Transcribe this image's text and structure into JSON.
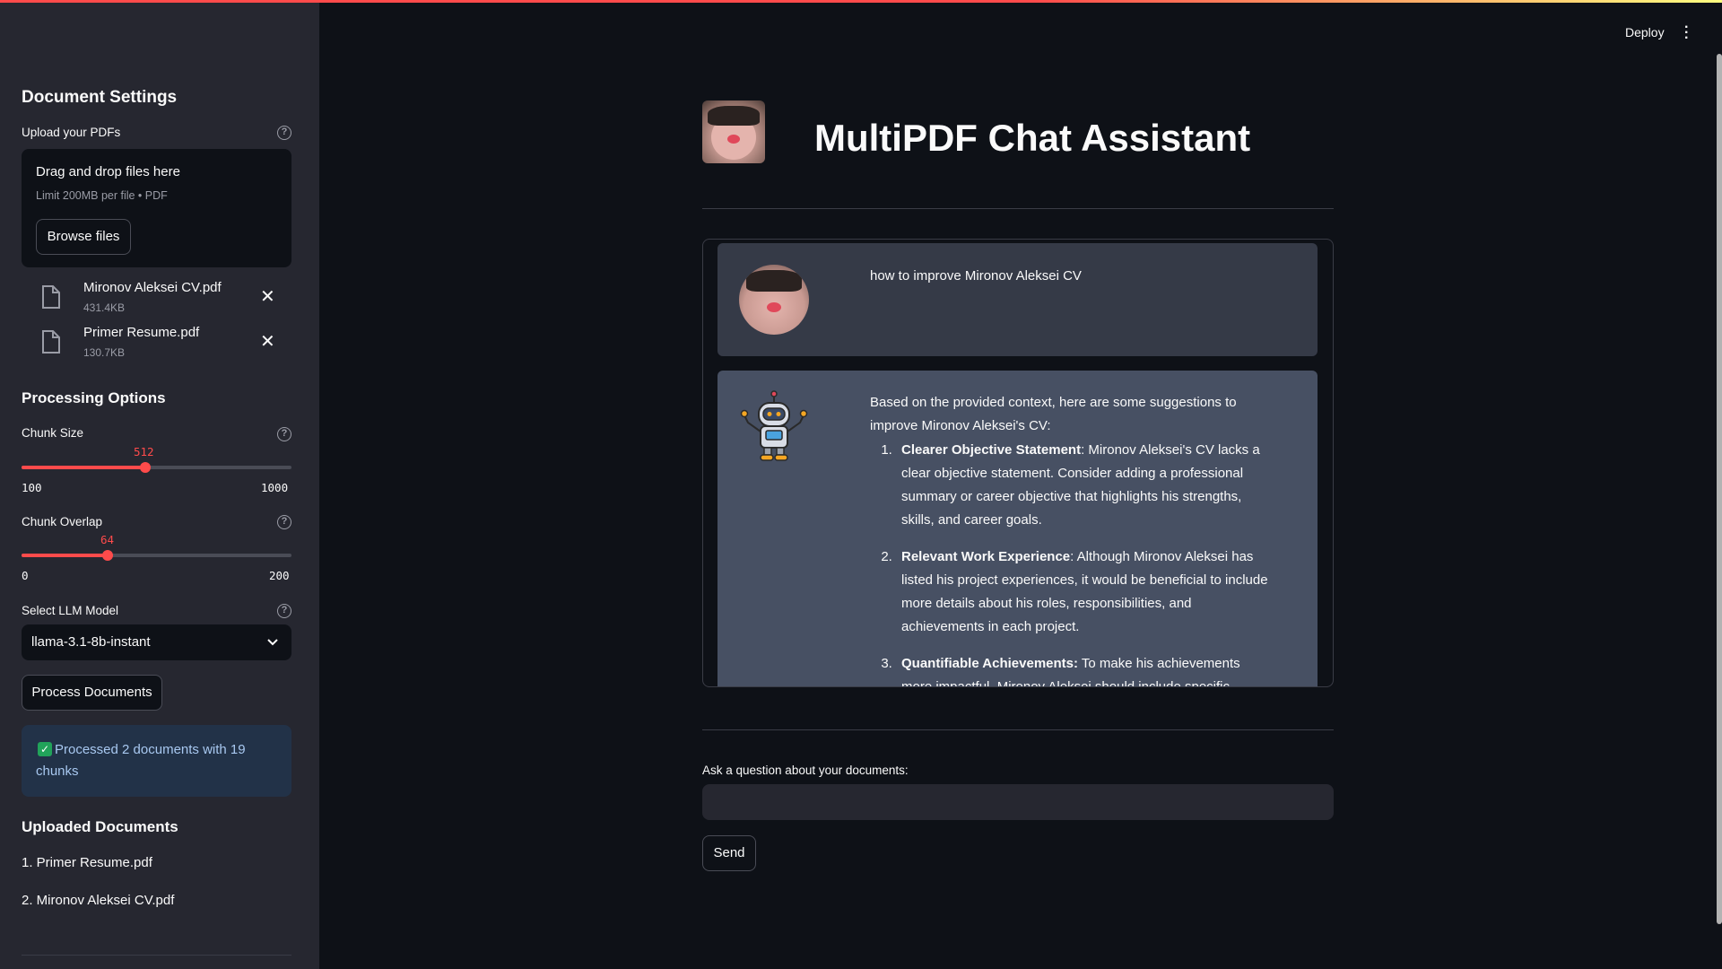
{
  "sidebar": {
    "settings_title": "Document Settings",
    "upload_label": "Upload your PDFs",
    "dropzone_title": "Drag and drop files here",
    "dropzone_limit": "Limit 200MB per file • PDF",
    "browse_label": "Browse files",
    "files": [
      {
        "name": "Mironov Aleksei CV.pdf",
        "size": "431.4KB"
      },
      {
        "name": "Primer Resume.pdf",
        "size": "130.7KB"
      }
    ],
    "processing_title": "Processing Options",
    "chunk_size": {
      "label": "Chunk Size",
      "value": "512",
      "min": "100",
      "max": "1000",
      "fraction": 0.458
    },
    "chunk_overlap": {
      "label": "Chunk Overlap",
      "value": "64",
      "min": "0",
      "max": "200",
      "fraction": 0.32
    },
    "model_label": "Select LLM Model",
    "model_value": "llama-3.1-8b-instant",
    "process_button": "Process Documents",
    "success_text": "Processed 2 documents with 19 chunks",
    "uploaded_title": "Uploaded Documents",
    "uploaded_docs": [
      "1. Primer Resume.pdf",
      "2. Mironov Aleksei CV.pdf"
    ]
  },
  "header": {
    "deploy_label": "Deploy"
  },
  "main": {
    "title": "MultiPDF Chat Assistant",
    "user_message": "how to improve Mironov Aleksei CV",
    "bot_intro": "Based on the provided context, here are some suggestions to improve Mironov Aleksei's CV:",
    "bot_points": [
      {
        "num": "1.",
        "title": "Clearer Objective Statement",
        "text": ": Mironov Aleksei's CV lacks a clear objective statement. Consider adding a professional summary or career objective that highlights his strengths, skills, and career goals."
      },
      {
        "num": "2.",
        "title": "Relevant Work Experience",
        "text": ": Although Mironov Aleksei has listed his project experiences, it would be beneficial to include more details about his roles, responsibilities, and achievements in each project."
      },
      {
        "num": "3.",
        "title": "Quantifiable Achievements:",
        "text": " To make his achievements more impactful, Mironov Aleksei should include specific numbers"
      }
    ],
    "ask_label": "Ask a question about your documents:",
    "ask_value": "",
    "send_label": "Send"
  },
  "colors": {
    "accent": "#ff4b4b",
    "sidebar_bg": "#262730",
    "main_bg": "#0e1117",
    "bot_bg": "#475063",
    "user_bg": "#353a47"
  }
}
